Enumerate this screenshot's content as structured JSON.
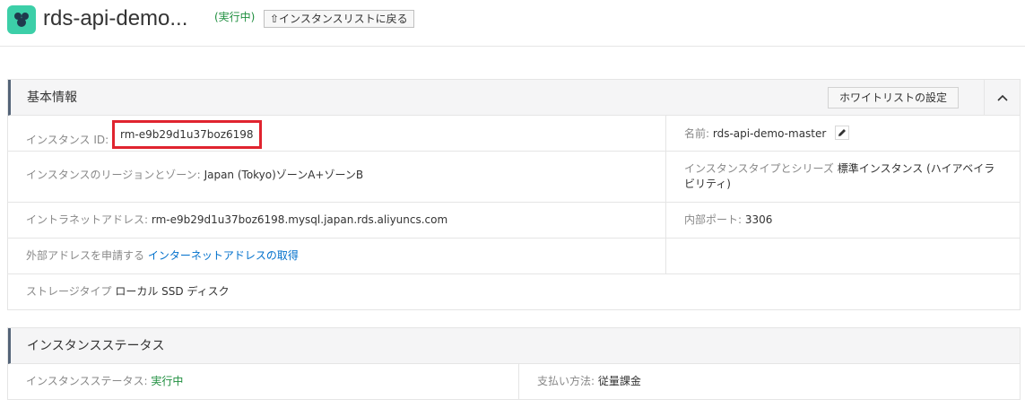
{
  "header": {
    "title": "rds-api-demo...",
    "status": "(実行中)",
    "back_label": "⇧インスタンスリストに戻る"
  },
  "basic_info": {
    "title": "基本情報",
    "whitelist_button": "ホワイトリストの設定",
    "instance_id_label": "インスタンス ID:",
    "instance_id": "rm-e9b29d1u37boz6198",
    "name_label": "名前:",
    "name": "rds-api-demo-master",
    "region_label": "インスタンスのリージョンとゾーン:",
    "region": "Japan (Tokyo)ゾーンA+ゾーンB",
    "type_label": "インスタンスタイプとシリーズ",
    "type": "標準インスタンス (ハイアベイラビリティ)",
    "intranet_label": "イントラネットアドレス:",
    "intranet": "rm-e9b29d1u37boz6198.mysql.japan.rds.aliyuncs.com",
    "port_label": "内部ポート:",
    "port": "3306",
    "external_label": "外部アドレスを申請する",
    "external_link": "インターネットアドレスの取得",
    "storage_label": "ストレージタイプ",
    "storage": "ローカル SSD ディスク"
  },
  "instance_status": {
    "title": "インスタンスステータス",
    "status_label": "インスタンスステータス:",
    "status": "実行中",
    "payment_label": "支払い方法:",
    "payment": "従量課金"
  },
  "colors": {
    "accent_border": "#546478",
    "highlight": "#e0242f",
    "link": "#0070cc",
    "running": "#1e8e3e",
    "app_icon": "#3ccfa8"
  },
  "icons": [
    "rds-app-icon",
    "chevron-up-icon",
    "edit-pencil-icon",
    "up-arrow-icon"
  ]
}
